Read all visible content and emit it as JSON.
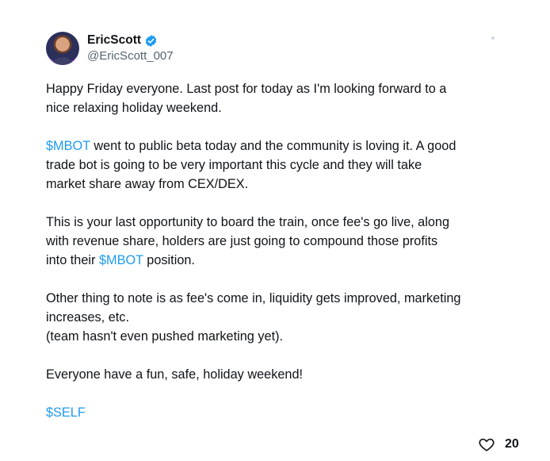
{
  "author": {
    "display_name": "EricScott",
    "handle": "@EricScott_007"
  },
  "post": {
    "p1": "Happy Friday everyone. Last post for today as I'm looking forward to a\nnice relaxing holiday weekend.",
    "p2_tag": "$MBOT",
    "p2_text": " went to public beta today and the community is loving it.  A good\ntrade bot is going to be very important this cycle and they will take\nmarket share away from CEX/DEX.",
    "p3_text": "This is your last opportunity to board the train, once fee's go live, along\nwith revenue share, holders are just going to compound those profits\ninto their ",
    "p3_tag": "$MBOT",
    "p3_end": " position.",
    "p4": "Other thing to note is as fee's come in, liquidity gets improved, marketing\nincreases, etc.\n(team hasn't even pushed marketing yet).",
    "p5": "Everyone have a fun, safe, holiday weekend!",
    "p6_tag": "$SELF"
  },
  "actions": {
    "like_count": "20"
  },
  "colors": {
    "link": "#1d9bf0",
    "verified": "#1d9bf0"
  },
  "icons": {
    "verified": "verified-badge-icon",
    "like": "heart-icon",
    "more": "more-dots-icon"
  }
}
